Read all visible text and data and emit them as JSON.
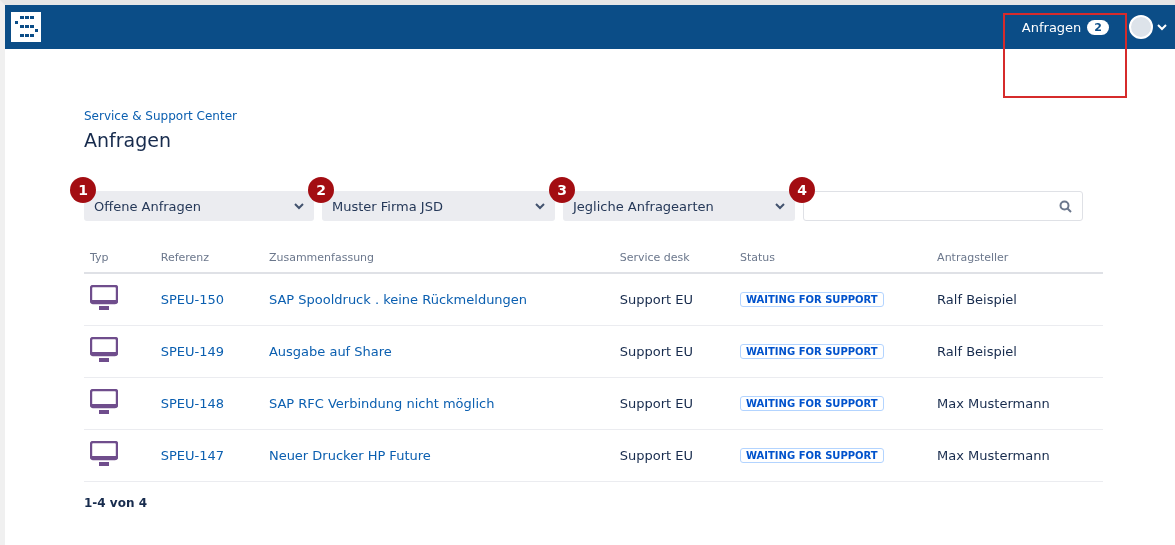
{
  "topbar": {
    "requests_link": {
      "label": "Anfragen",
      "count": "2",
      "highlighted": true
    }
  },
  "breadcrumb": "Service & Support Center",
  "title": "Anfragen",
  "filters": [
    {
      "kind": "select",
      "marker": "1",
      "value": "Offene Anfragen"
    },
    {
      "kind": "select",
      "marker": "2",
      "value": "Muster Firma JSD"
    },
    {
      "kind": "select",
      "marker": "3",
      "value": "Jegliche Anfragearten"
    },
    {
      "kind": "search",
      "marker": "4"
    }
  ],
  "table": {
    "columns": [
      "Typ",
      "Referenz",
      "Zusammenfassung",
      "Service desk",
      "Status",
      "Antragsteller"
    ],
    "rows": [
      {
        "reference": "SPEU-150",
        "summary": "SAP Spooldruck . keine Rückmeldungen",
        "service_desk": "Support EU",
        "status": "WAITING FOR SUPPORT",
        "requester": "Ralf Beispiel"
      },
      {
        "reference": "SPEU-149",
        "summary": "Ausgabe auf Share",
        "service_desk": "Support EU",
        "status": "WAITING FOR SUPPORT",
        "requester": "Ralf Beispiel"
      },
      {
        "reference": "SPEU-148",
        "summary": "SAP RFC Verbindung nicht möglich",
        "service_desk": "Support EU",
        "status": "WAITING FOR SUPPORT",
        "requester": "Max Mustermann"
      },
      {
        "reference": "SPEU-147",
        "summary": "Neuer Drucker HP Future",
        "service_desk": "Support EU",
        "status": "WAITING FOR SUPPORT",
        "requester": "Max Mustermann"
      }
    ]
  },
  "pagination": "1-4 von 4"
}
